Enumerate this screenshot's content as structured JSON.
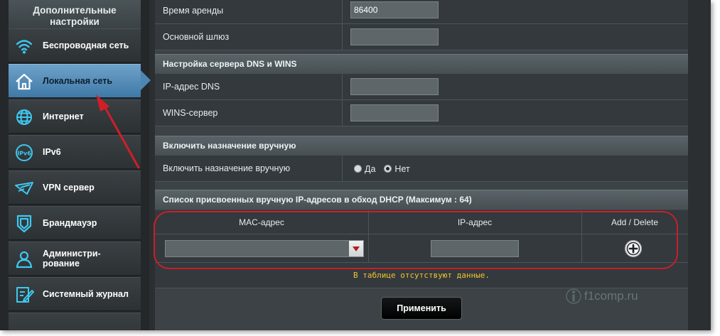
{
  "sidebar": {
    "header": "Дополнительные настройки",
    "items": [
      {
        "label": "Беспроводная сеть",
        "icon": "wifi-icon"
      },
      {
        "label": "Локальная сеть",
        "icon": "home-icon",
        "active": true
      },
      {
        "label": "Интернет",
        "icon": "globe-icon"
      },
      {
        "label": "IPv6",
        "icon": "ipv6-icon"
      },
      {
        "label": "VPN сервер",
        "icon": "vpn-icon"
      },
      {
        "label": "Брандмауэр",
        "icon": "shield-icon"
      },
      {
        "label": "Администри-рование",
        "icon": "person-icon"
      },
      {
        "label": "Системный журнал",
        "icon": "log-icon"
      }
    ]
  },
  "main": {
    "lease_time": {
      "label": "Время аренды",
      "value": "86400"
    },
    "gateway": {
      "label": "Основной шлюз",
      "value": ""
    },
    "dns_section": {
      "title": "Настройка сервера DNS и WINS",
      "dns": {
        "label": "IP-адрес DNS",
        "value": ""
      },
      "wins": {
        "label": "WINS-сервер",
        "value": ""
      }
    },
    "manual_section": {
      "title": "Включить назначение вручную",
      "label": "Включить назначение вручную",
      "options": [
        "Да",
        "Нет"
      ],
      "selected": "Нет"
    },
    "dhcp_list": {
      "title": "Список присвоенных вручную IP-адресов в обход DHCP (Максимум : 64)",
      "columns": [
        "MAC-адрес",
        "IP-адрес",
        "Add / Delete"
      ],
      "empty_text": "В таблице отсутствуют данные."
    },
    "apply_label": "Применить"
  },
  "watermark": "f1comp.ru",
  "colors": {
    "accent_blue": "#3f79a7",
    "annotation_red": "#c8202a",
    "empty_text": "#f3c531"
  }
}
